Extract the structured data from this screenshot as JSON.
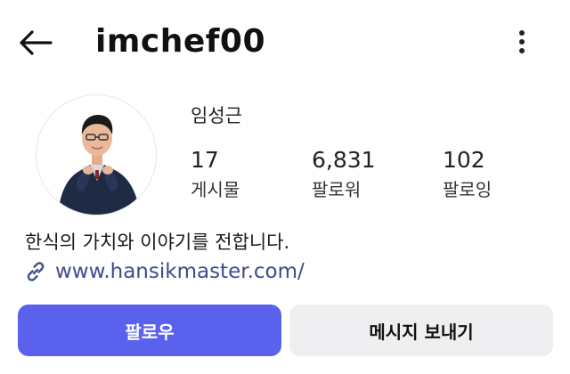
{
  "header": {
    "username": "imchef00"
  },
  "profile": {
    "display_name": "임성근",
    "stats": {
      "posts": {
        "value": "17",
        "label": "게시물"
      },
      "followers": {
        "value": "6,831",
        "label": "팔로워"
      },
      "following": {
        "value": "102",
        "label": "팔로잉"
      }
    },
    "bio": "한식의 가치와 이야기를 전합니다.",
    "link": "www.hansikmaster.com/"
  },
  "actions": {
    "follow_label": "팔로우",
    "message_label": "메시지 보내기"
  },
  "colors": {
    "follow_button": "#5a61ec",
    "message_button": "#efeff1",
    "link_text": "#3f4c8c"
  },
  "icons": [
    "back-arrow-icon",
    "more-vertical-icon",
    "link-icon"
  ]
}
